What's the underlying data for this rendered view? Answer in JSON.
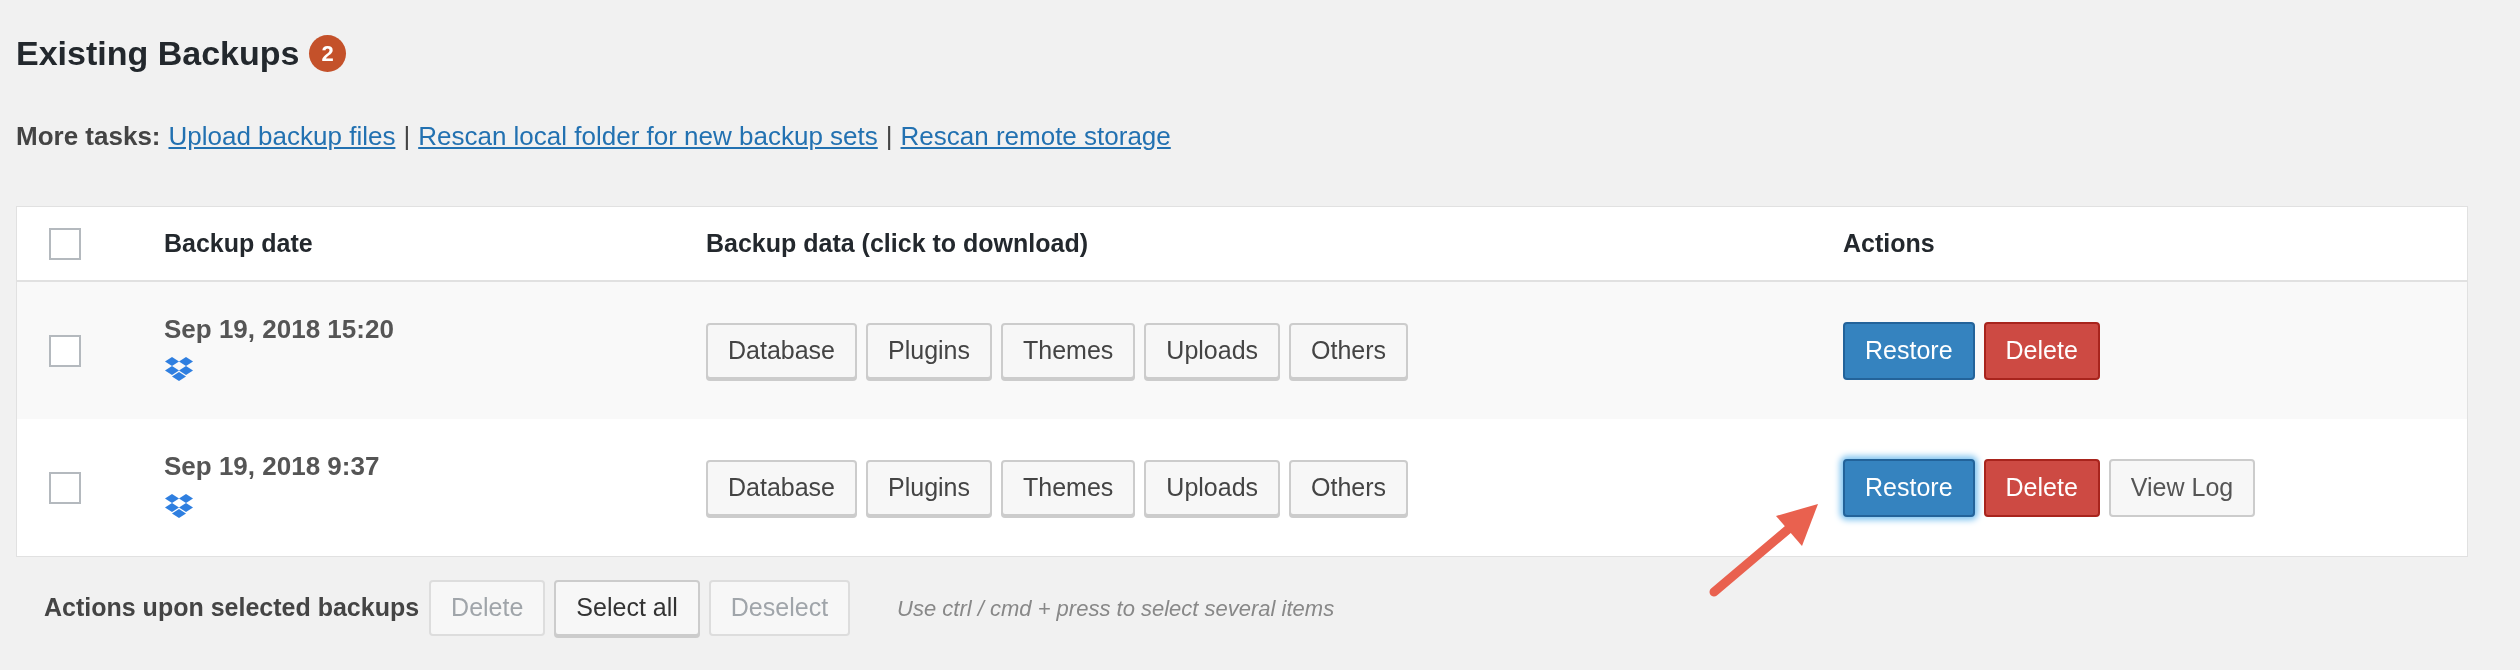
{
  "heading": {
    "title": "Existing Backups",
    "count": "2"
  },
  "more_tasks": {
    "label": "More tasks:",
    "links": [
      "Upload backup files",
      "Rescan local folder for new backup sets",
      "Rescan remote storage"
    ],
    "separators": [
      "|",
      "|"
    ]
  },
  "table": {
    "header_checkbox": {
      "checked": false
    },
    "columns": [
      "Backup date",
      "Backup data (click to download)",
      "Actions"
    ],
    "rows": [
      {
        "checked": false,
        "date": "Sep 19, 2018 15:20",
        "data_buttons": [
          "Database",
          "Plugins",
          "Themes",
          "Uploads",
          "Others"
        ],
        "actions": [
          {
            "kind": "restore",
            "label": "Restore",
            "focused": false
          },
          {
            "kind": "delete",
            "label": "Delete"
          }
        ]
      },
      {
        "checked": false,
        "date": "Sep 19, 2018 9:37",
        "data_buttons": [
          "Database",
          "Plugins",
          "Themes",
          "Uploads",
          "Others"
        ],
        "actions": [
          {
            "kind": "restore",
            "label": "Restore",
            "focused": true
          },
          {
            "kind": "delete",
            "label": "Delete"
          },
          {
            "kind": "log",
            "label": "View Log"
          }
        ]
      }
    ]
  },
  "bulk": {
    "label": "Actions upon selected backups",
    "buttons": [
      {
        "label": "Delete",
        "disabled": true
      },
      {
        "label": "Select all",
        "disabled": false
      },
      {
        "label": "Deselect",
        "disabled": true
      }
    ],
    "hint": "Use ctrl / cmd + press to select several items"
  }
}
